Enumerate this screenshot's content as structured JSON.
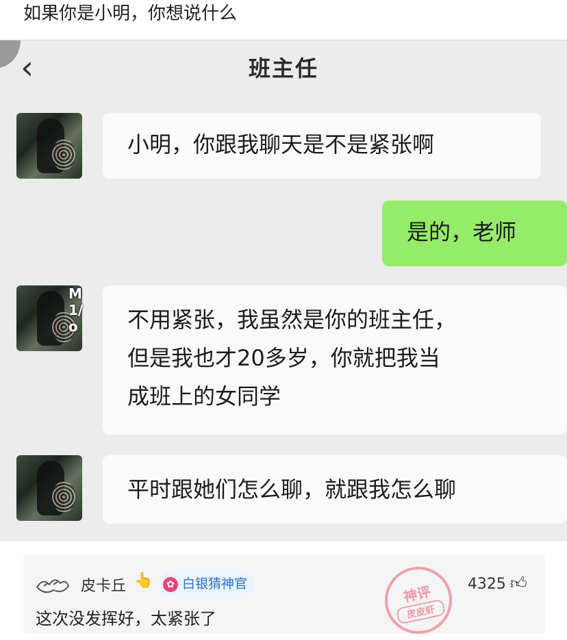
{
  "post": {
    "title": "如果你是小明，你想说什么"
  },
  "chat": {
    "back_icon": "chevron-left-icon",
    "title": "班主任",
    "messages": [
      {
        "side": "left",
        "lines": [
          "小明，你跟我聊天是不是紧张啊"
        ]
      },
      {
        "side": "right",
        "lines": [
          "是的，老师"
        ]
      },
      {
        "side": "left",
        "lines": [
          "不用紧张，我虽然是你的班主任，",
          "但是我也才20多岁，你就把我当",
          "成班上的女同学"
        ]
      },
      {
        "side": "left",
        "lines": [
          "平时跟她们怎么聊，就跟我怎么聊"
        ]
      }
    ],
    "bubble_colors": {
      "left": "#fafafa",
      "right": "#95ec69"
    }
  },
  "comment": {
    "username": "皮卡丘",
    "finger_icon": "👆",
    "badge_label": "白银猜神官",
    "text": "这次没发挥好，太紧张了",
    "likes": "4325",
    "stamp_top": "神评",
    "stamp_bottom": "皮皮虾"
  }
}
